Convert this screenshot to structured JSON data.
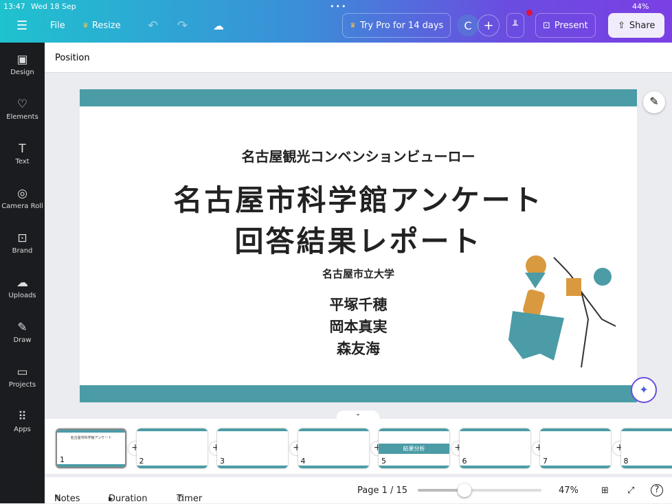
{
  "status": {
    "time": "13:47",
    "date": "Wed 18 Sep",
    "battery": "44%"
  },
  "toolbar": {
    "file": "File",
    "resize": "Resize",
    "try_pro": "Try Pro for 14 days",
    "avatar": "C",
    "present": "Present",
    "share": "Share"
  },
  "sidebar": {
    "items": [
      {
        "label": "Design",
        "icon": "▣"
      },
      {
        "label": "Elements",
        "icon": "♡"
      },
      {
        "label": "Text",
        "icon": "T"
      },
      {
        "label": "Camera Roll",
        "icon": "◎"
      },
      {
        "label": "Brand",
        "icon": "⊡"
      },
      {
        "label": "Uploads",
        "icon": "☁"
      },
      {
        "label": "Draw",
        "icon": "✎"
      },
      {
        "label": "Projects",
        "icon": "▭"
      },
      {
        "label": "Apps",
        "icon": "⠿"
      }
    ]
  },
  "position_label": "Position",
  "slide": {
    "org": "名古屋観光コンベンションビューロー",
    "title1": "名古屋市科学館アンケート",
    "title2": "回答結果レポート",
    "university": "名古屋市立大学",
    "authors": [
      "平塚千穂",
      "岡本真実",
      "森友海"
    ],
    "accent": "#4b9ca6"
  },
  "filmstrip": [
    {
      "n": "1",
      "title": "名古屋市科学館アンケート"
    },
    {
      "n": "2",
      "title": ""
    },
    {
      "n": "3",
      "title": ""
    },
    {
      "n": "4",
      "title": ""
    },
    {
      "n": "5",
      "title": "結果分析"
    },
    {
      "n": "6",
      "title": ""
    },
    {
      "n": "7",
      "title": ""
    },
    {
      "n": "8",
      "title": ""
    }
  ],
  "bottom": {
    "notes": "Notes",
    "duration": "Duration",
    "timer": "Timer",
    "page": "Page 1 / 15",
    "zoom": "47%",
    "zoom_value": 47
  }
}
